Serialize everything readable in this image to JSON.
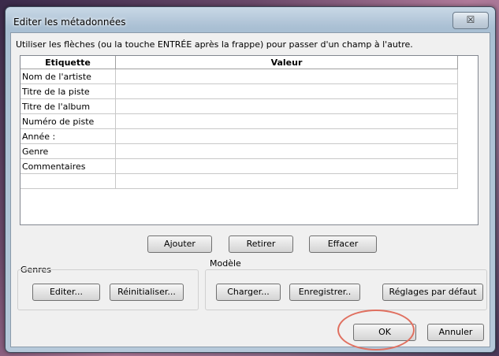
{
  "window": {
    "title": "Editer les métadonnées",
    "close_glyph": "☒"
  },
  "instruction": "Utiliser les flèches (ou la touche ENTRÉE après la frappe) pour passer d'un champ à l'autre.",
  "table": {
    "headers": [
      "Etiquette",
      "Valeur"
    ],
    "rows": [
      {
        "label": "Nom de l'artiste",
        "value": ""
      },
      {
        "label": "Titre de la piste",
        "value": ""
      },
      {
        "label": "Titre de l'album",
        "value": ""
      },
      {
        "label": "Numéro de piste",
        "value": ""
      },
      {
        "label": "Année :",
        "value": ""
      },
      {
        "label": "Genre",
        "value": ""
      },
      {
        "label": "Commentaires",
        "value": ""
      },
      {
        "label": "",
        "value": ""
      }
    ]
  },
  "actions": {
    "add": "Ajouter",
    "remove": "Retirer",
    "clear": "Effacer"
  },
  "genres": {
    "label": "Genres",
    "edit": "Editer...",
    "reset": "Réinitialiser..."
  },
  "model": {
    "label": "Modèle",
    "load": "Charger...",
    "save": "Enregistrer..",
    "defaults": "Réglages par défaut"
  },
  "footer": {
    "ok": "OK",
    "cancel": "Annuler"
  },
  "colors": {
    "annotation_circle": "#e07060"
  }
}
